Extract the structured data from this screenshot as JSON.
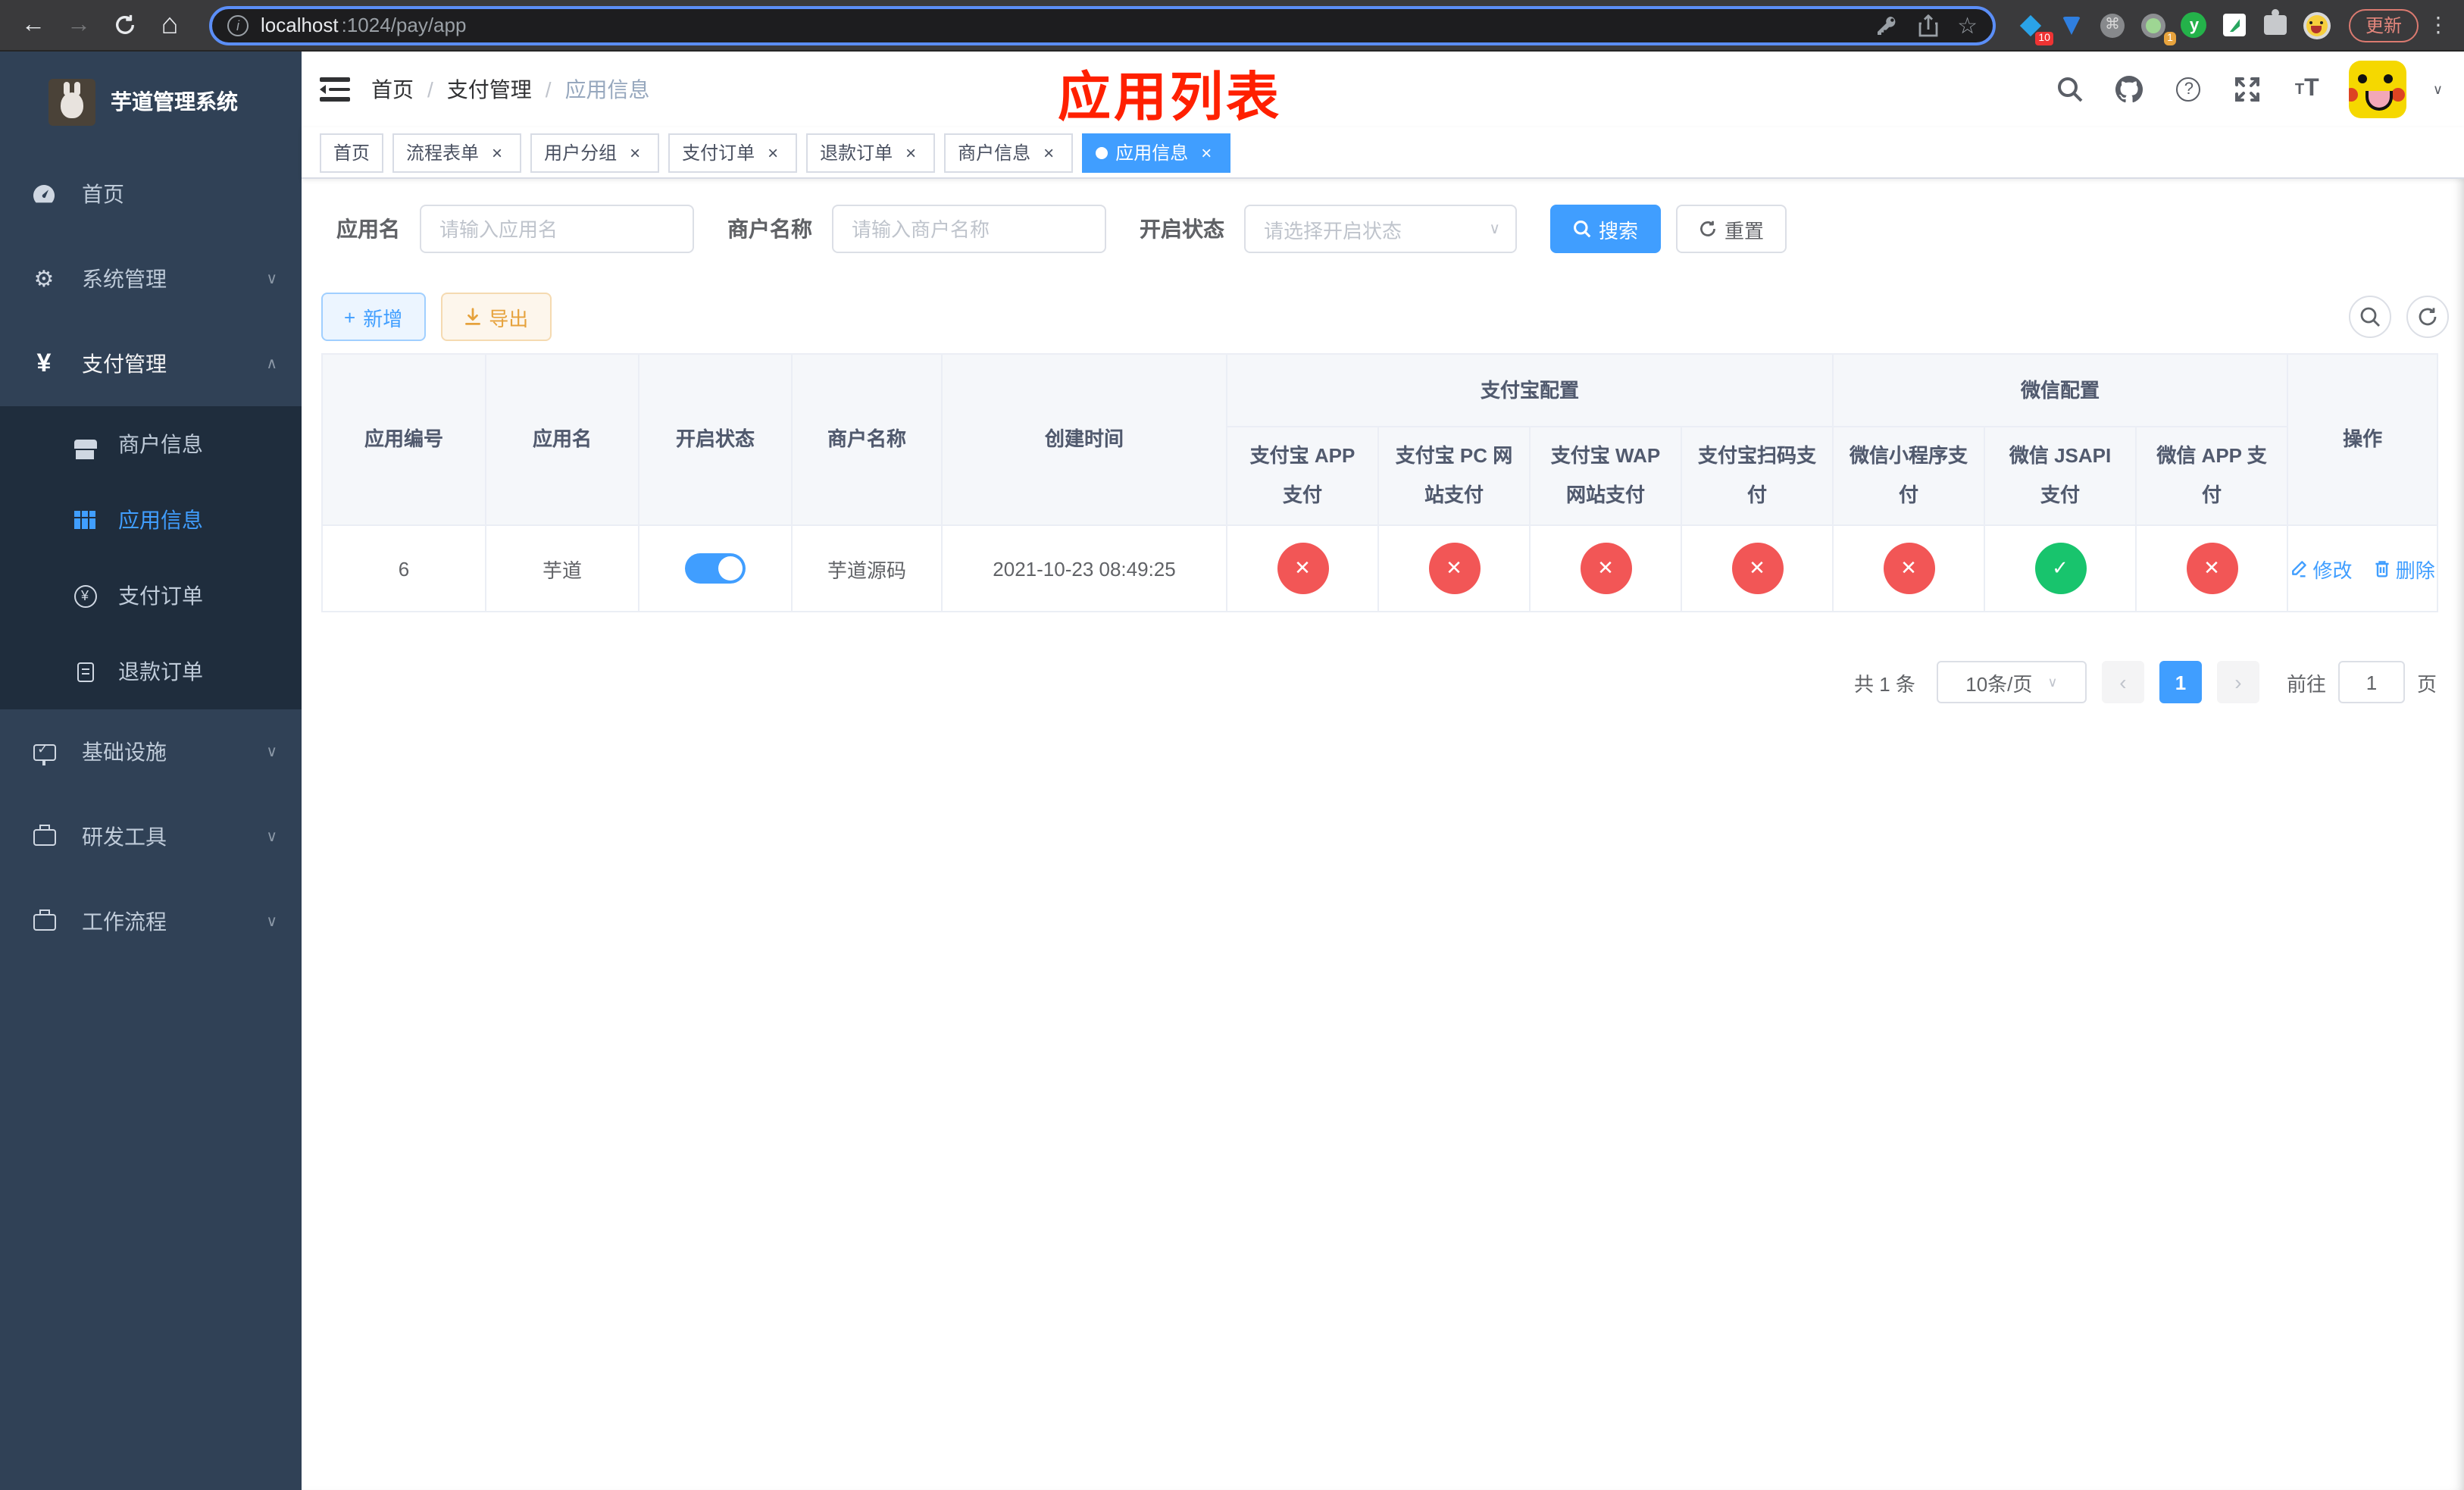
{
  "colors": {
    "accent": "#409eff",
    "success": "#18c46d",
    "danger": "#f25656",
    "warning": "#e6a23c",
    "sidebar_bg": "#304156",
    "submenu_bg": "#1f2d3d",
    "annotation_red": "#ff2000"
  },
  "glyphs": {
    "back": "←",
    "forward": "→",
    "home": "⌂",
    "info": "i",
    "star": "☆",
    "command": "⌘",
    "dots": "⋮",
    "yen": "¥",
    "gear": "⚙",
    "plus": "+",
    "close": "×",
    "question": "?",
    "check": "✓",
    "cross": "✕",
    "prev": "‹",
    "next": "›",
    "caret_down": "∨",
    "caret_up": "∧",
    "letter_t": "T"
  },
  "browser": {
    "url_host": "localhost",
    "url_path": ":1024/pay/app",
    "ext_badge_blue_diamond": "10",
    "ext_badge_gray_circle": "1",
    "ext_y_label": "y",
    "update_label": "更新"
  },
  "sidebar": {
    "title": "芋道管理系统",
    "items": [
      {
        "label": "首页"
      },
      {
        "label": "系统管理"
      },
      {
        "label": "支付管理"
      },
      {
        "label": "基础设施"
      },
      {
        "label": "研发工具"
      },
      {
        "label": "工作流程"
      }
    ],
    "pay_submenu": [
      {
        "label": "商户信息"
      },
      {
        "label": "应用信息"
      },
      {
        "label": "支付订单"
      },
      {
        "label": "退款订单"
      }
    ]
  },
  "navbar": {
    "breadcrumb": [
      "首页",
      "支付管理",
      "应用信息"
    ],
    "separator": "/"
  },
  "annotation": "应用列表",
  "tags": [
    {
      "label": "首页"
    },
    {
      "label": "流程表单"
    },
    {
      "label": "用户分组"
    },
    {
      "label": "支付订单"
    },
    {
      "label": "退款订单"
    },
    {
      "label": "商户信息"
    },
    {
      "label": "应用信息"
    }
  ],
  "filters": {
    "app_name_label": "应用名",
    "app_name_placeholder": "请输入应用名",
    "merchant_label": "商户名称",
    "merchant_placeholder": "请输入商户名称",
    "status_label": "开启状态",
    "status_placeholder": "请选择开启状态",
    "search_label": "搜索",
    "reset_label": "重置"
  },
  "toolbar": {
    "add_label": "新增",
    "export_label": "导出"
  },
  "table": {
    "main_headers": [
      "应用编号",
      "应用名",
      "开启状态",
      "商户名称",
      "创建时间"
    ],
    "groups": [
      "支付宝配置",
      "微信配置"
    ],
    "sub_headers": [
      "支付宝 APP 支付",
      "支付宝 PC 网站支付",
      "支付宝 WAP 网站支付",
      "支付宝扫码支付",
      "微信小程序支付",
      "微信 JSAPI 支付",
      "微信 APP 支付"
    ],
    "op_header": "操作",
    "row": {
      "id": "6",
      "name": "芋道",
      "switch_on": true,
      "merchant": "芋道源码",
      "created": "2021-10-23 08:49:25",
      "status_glyphs": [
        "✕",
        "✕",
        "✕",
        "✕",
        "✕",
        "✓",
        "✕"
      ],
      "edit_label": "修改",
      "delete_label": "删除"
    }
  },
  "pagination": {
    "total_label": "共 1 条",
    "page_size_label": "10条/页",
    "current_page": "1",
    "goto_label": "前往",
    "goto_value": "1",
    "page_unit_label": "页"
  }
}
